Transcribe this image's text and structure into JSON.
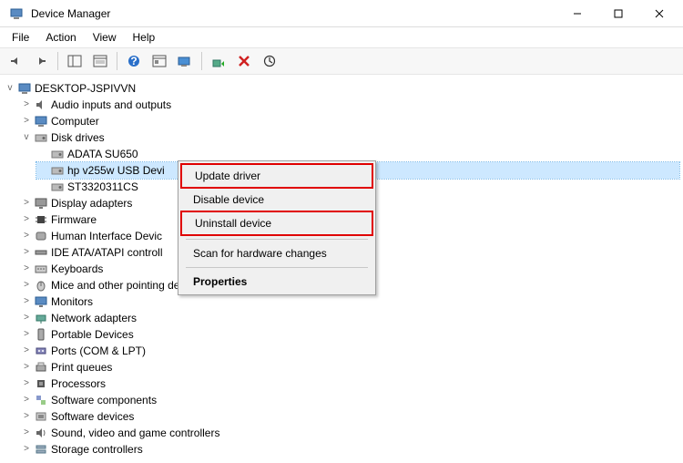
{
  "window": {
    "title": "Device Manager"
  },
  "menubar": [
    "File",
    "Action",
    "View",
    "Help"
  ],
  "tree": {
    "root": "DESKTOP-JSPIVVN",
    "audio": "Audio inputs and outputs",
    "computer": "Computer",
    "disk_drives": "Disk drives",
    "disk_children": [
      "ADATA SU650",
      "hp v255w USB Devi",
      "ST3320311CS"
    ],
    "display": "Display adapters",
    "firmware": "Firmware",
    "hid": "Human Interface Devic",
    "ide": "IDE ATA/ATAPI controll",
    "keyboards": "Keyboards",
    "mice": "Mice and other pointing devices",
    "monitors": "Monitors",
    "network": "Network adapters",
    "portable": "Portable Devices",
    "ports": "Ports (COM & LPT)",
    "printq": "Print queues",
    "processors": "Processors",
    "swcomp": "Software components",
    "swdev": "Software devices",
    "sound": "Sound, video and game controllers",
    "storage": "Storage controllers"
  },
  "context_menu": {
    "update": "Update driver",
    "disable": "Disable device",
    "uninstall": "Uninstall device",
    "scan": "Scan for hardware changes",
    "properties": "Properties"
  }
}
